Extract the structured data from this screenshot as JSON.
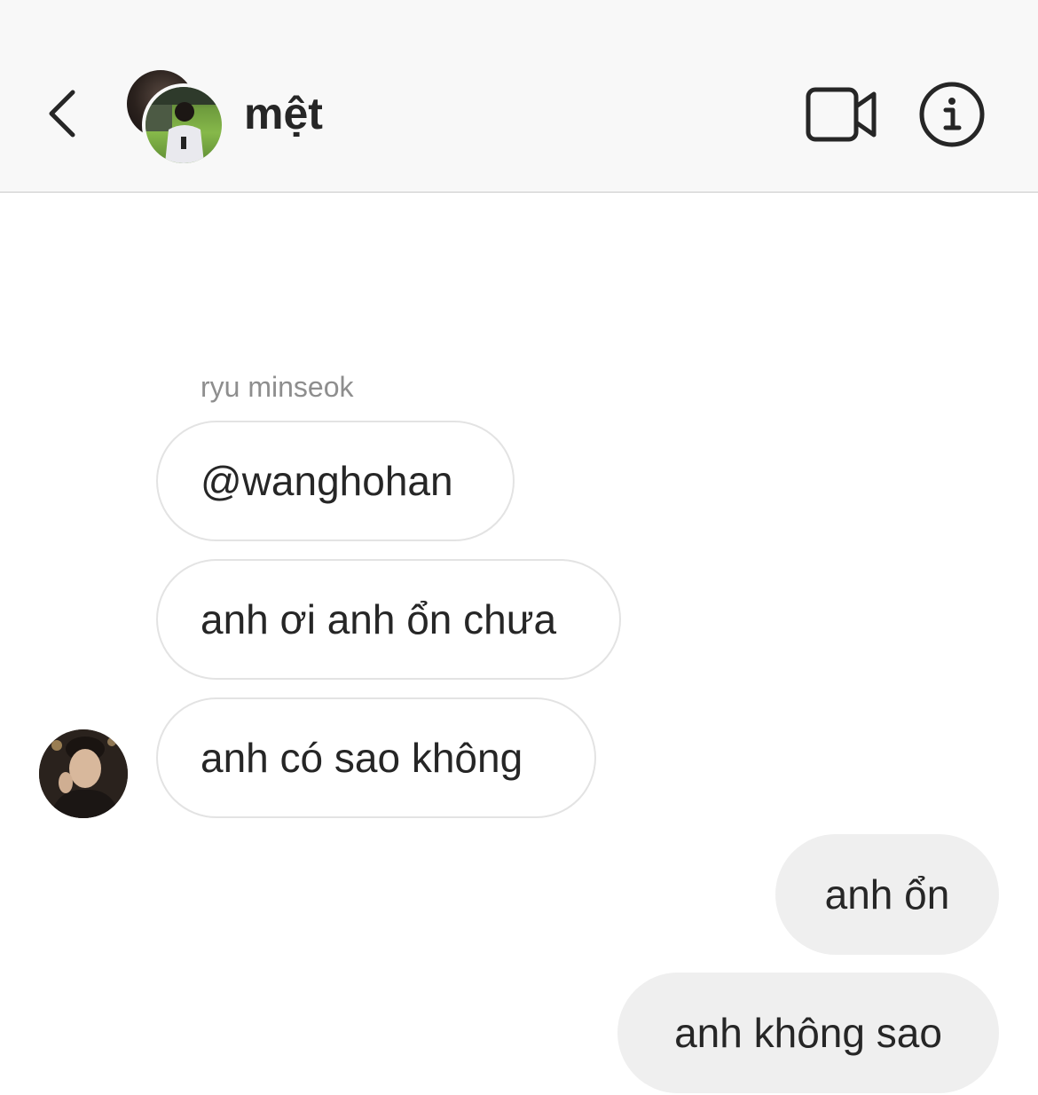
{
  "header": {
    "title": "mệt",
    "back_icon": "chevron-left-icon",
    "video_icon": "video-camera-icon",
    "info_icon": "info-icon"
  },
  "thread": {
    "sender_name": "ryu minseok",
    "incoming": [
      {
        "text": "@wanghohan"
      },
      {
        "text": "anh ơi anh ổn chưa"
      },
      {
        "text": "anh có sao không"
      }
    ],
    "outgoing": [
      {
        "text": "anh ổn"
      },
      {
        "text": "anh không sao"
      }
    ]
  },
  "colors": {
    "header_bg": "#f8f8f8",
    "incoming_border": "#e3e3e3",
    "outgoing_bg": "#efefef",
    "text": "#262626",
    "muted": "#8e8e8e"
  }
}
